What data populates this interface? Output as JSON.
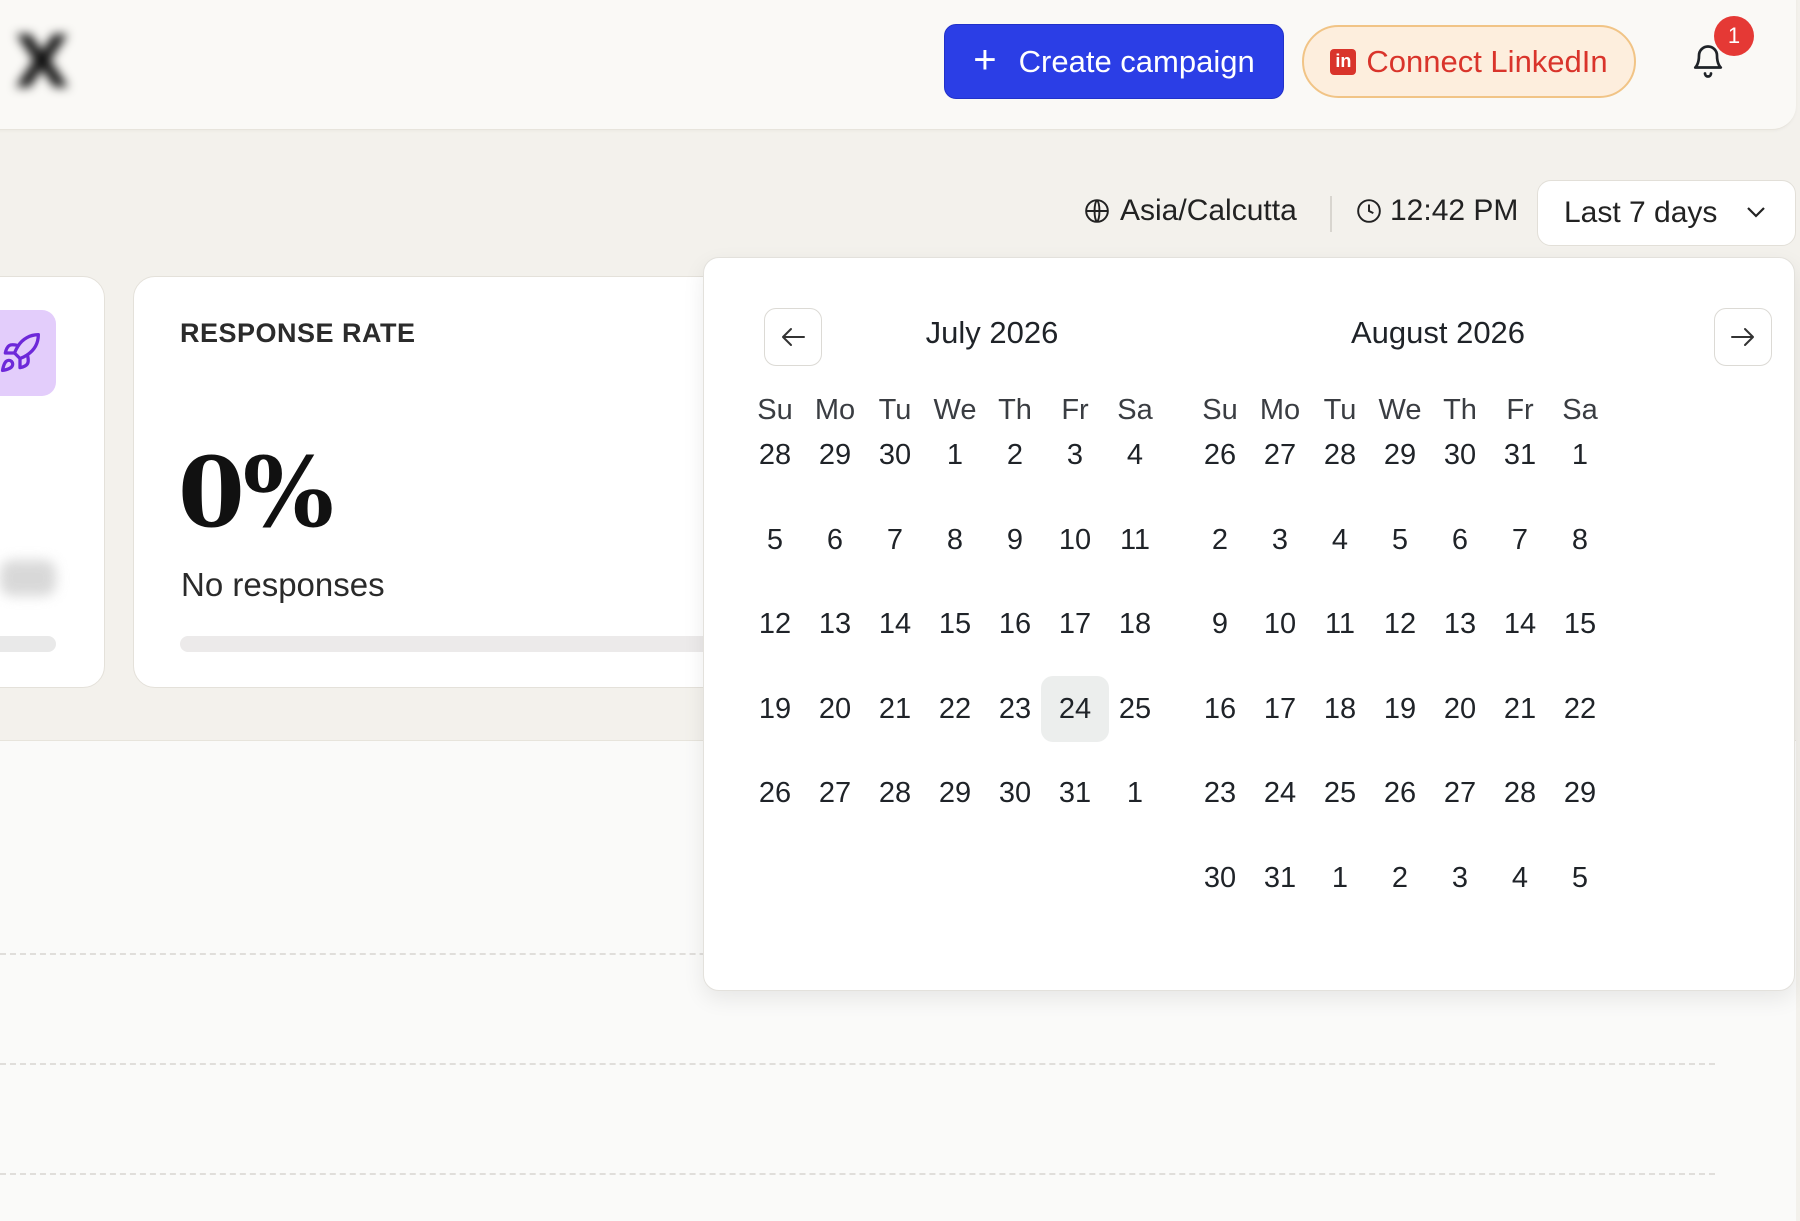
{
  "header": {
    "create_label": "Create campaign",
    "linkedin_label": "Connect LinkedIn",
    "notification_count": "1",
    "icons": {
      "create": "plus-icon",
      "linkedin": "linkedin-icon",
      "bell": "bell-icon"
    },
    "colors": {
      "primary": "#2b3ee6",
      "linkedin_bg": "#fdeedd",
      "linkedin_text": "#d9342b",
      "badge": "#e53935"
    }
  },
  "filters": {
    "timezone": "Asia/Calcutta",
    "time": "12:42 PM",
    "range": "Last 7 days"
  },
  "cards": {
    "response": {
      "title": "RESPONSE RATE",
      "value": "0%",
      "subtitle": "No responses",
      "progress": 0
    }
  },
  "calendar": {
    "weekdays": [
      "Su",
      "Mo",
      "Tu",
      "We",
      "Th",
      "Fr",
      "Sa"
    ],
    "months": [
      {
        "title": "July 2026",
        "weeks": [
          [
            "28",
            "29",
            "30",
            "1",
            "2",
            "3",
            "4"
          ],
          [
            "5",
            "6",
            "7",
            "8",
            "9",
            "10",
            "11"
          ],
          [
            "12",
            "13",
            "14",
            "15",
            "16",
            "17",
            "18"
          ],
          [
            "19",
            "20",
            "21",
            "22",
            "23",
            "24",
            "25"
          ],
          [
            "26",
            "27",
            "28",
            "29",
            "30",
            "31",
            "1"
          ]
        ]
      },
      {
        "title": "August 2026",
        "weeks": [
          [
            "26",
            "27",
            "28",
            "29",
            "30",
            "31",
            "1"
          ],
          [
            "2",
            "3",
            "4",
            "5",
            "6",
            "7",
            "8"
          ],
          [
            "9",
            "10",
            "11",
            "12",
            "13",
            "14",
            "15"
          ],
          [
            "16",
            "17",
            "18",
            "19",
            "20",
            "21",
            "22"
          ],
          [
            "23",
            "24",
            "25",
            "26",
            "27",
            "28",
            "29"
          ],
          [
            "30",
            "31",
            "1",
            "2",
            "3",
            "4",
            "5"
          ]
        ]
      }
    ],
    "today": {
      "month": 0,
      "week": 3,
      "day": 5
    }
  }
}
